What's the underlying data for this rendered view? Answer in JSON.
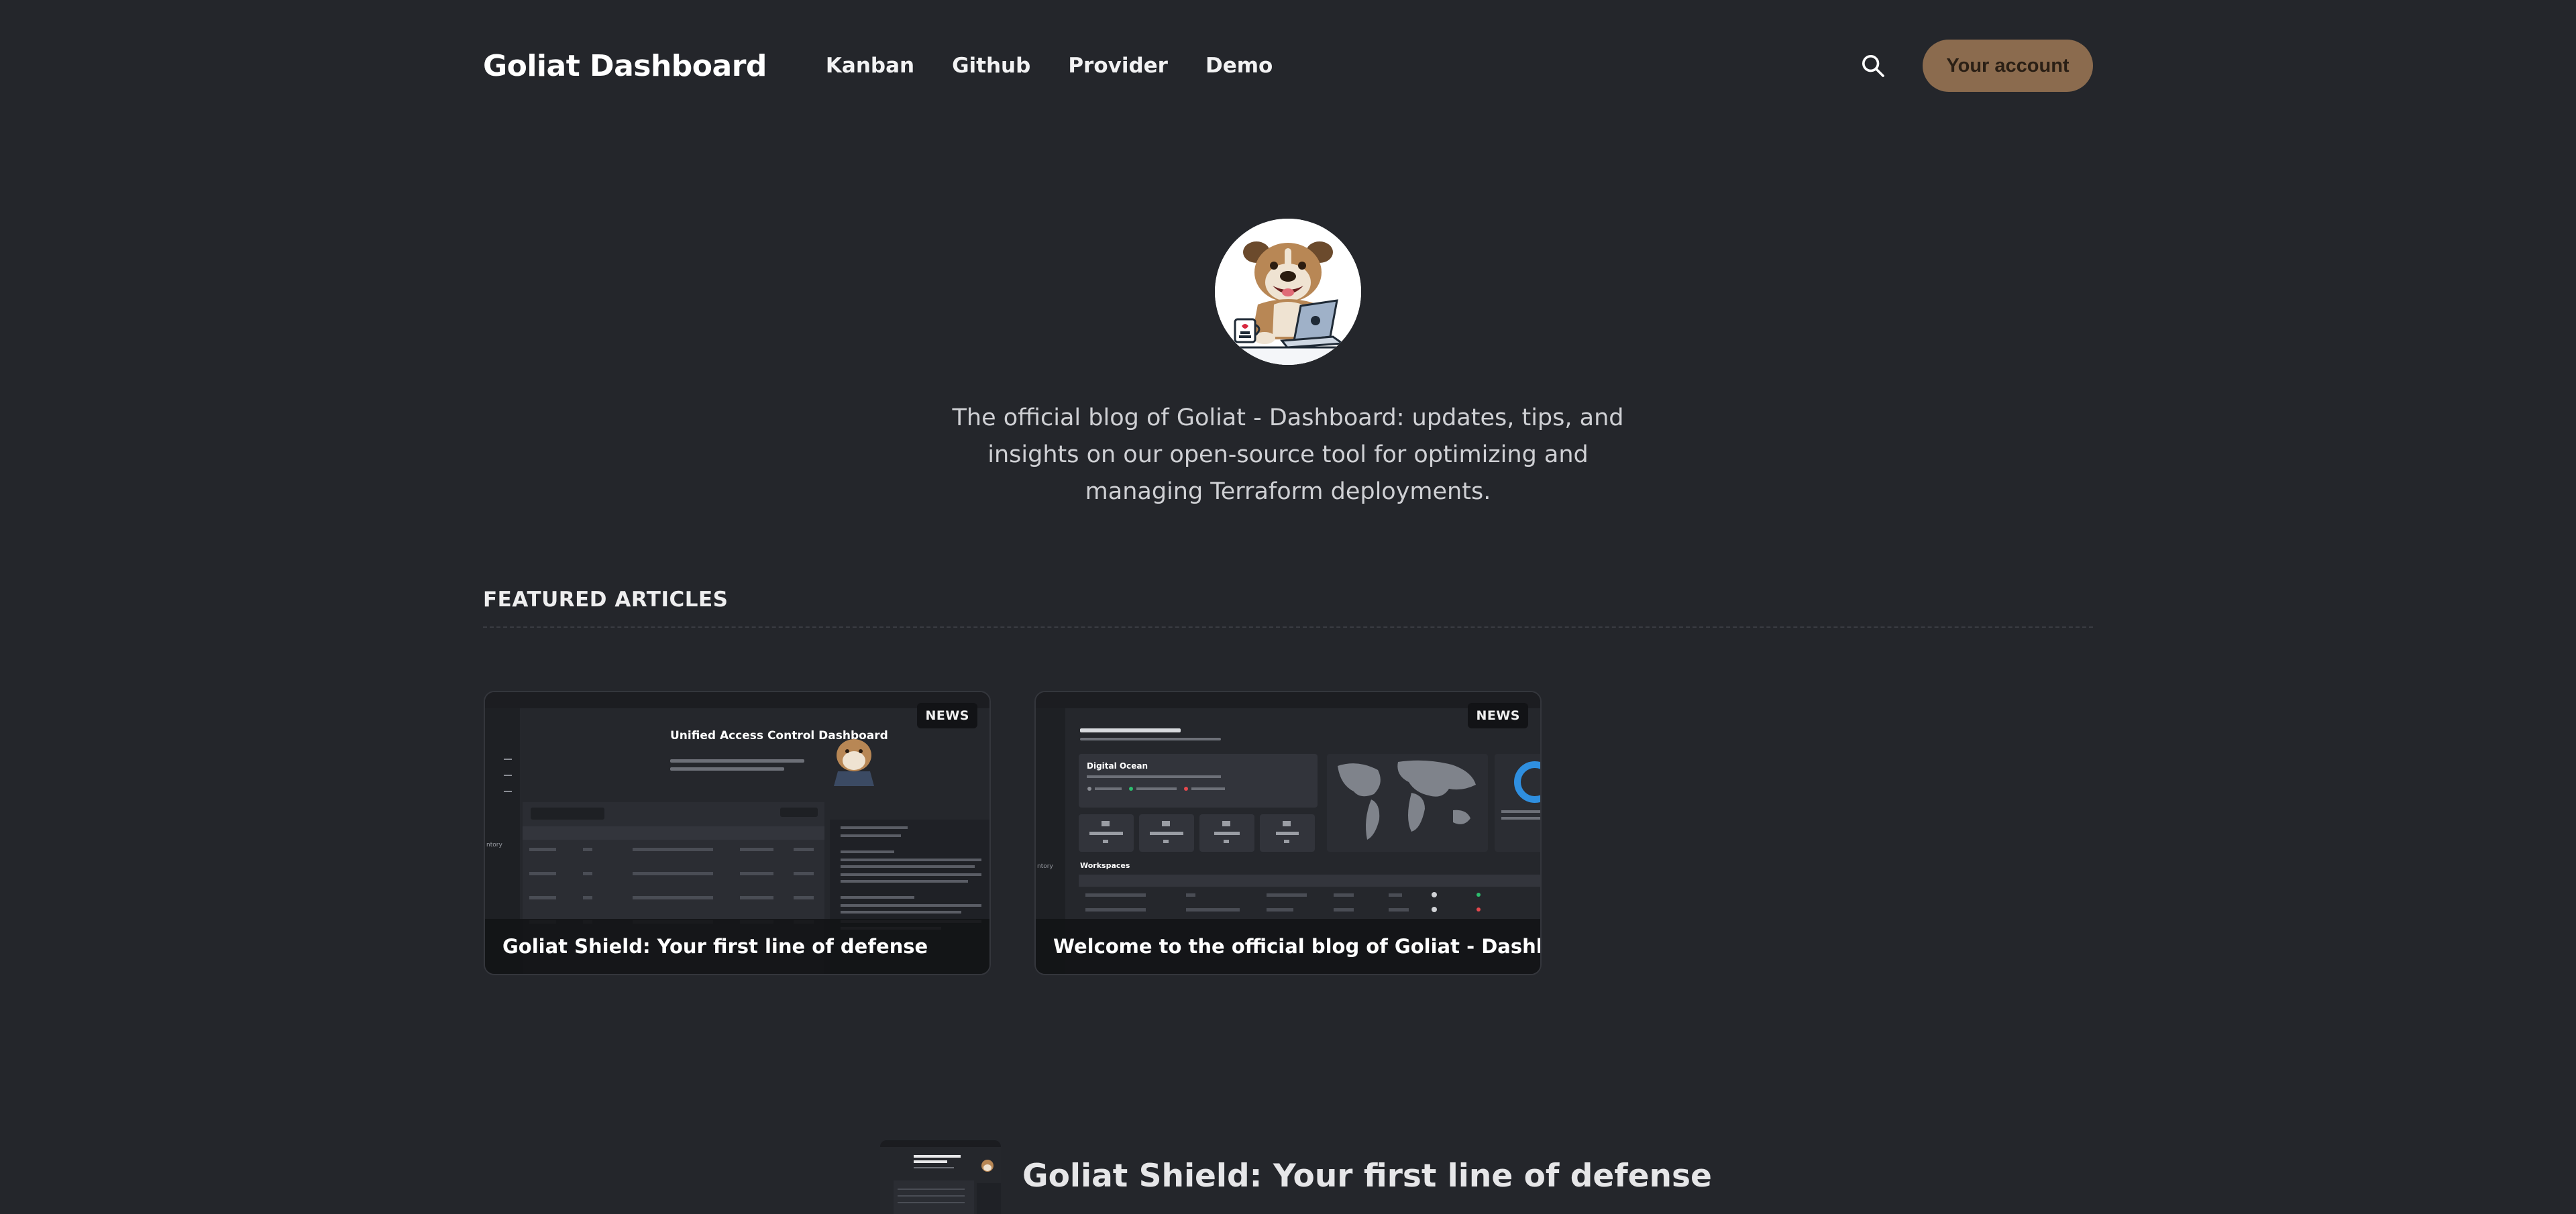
{
  "header": {
    "brand": "Goliat Dashboard",
    "nav": [
      "Kanban",
      "Github",
      "Provider",
      "Demo"
    ],
    "account_label": "Your account"
  },
  "hero": {
    "tagline": "The official blog of Goliat - Dashboard: updates, tips, and insights on our open-source tool for optimizing and managing Terraform deployments."
  },
  "featured": {
    "title": "FEATURED ARTICLES",
    "articles": [
      {
        "badge": "NEWS",
        "title": "Goliat Shield: Your first line of defense",
        "preview_heading": "Unified Access Control Dashboard"
      },
      {
        "badge": "NEWS",
        "title": "Welcome to the official blog of Goliat - Dashboard! 🚀",
        "preview_heading": "Digital Ocean",
        "preview_section": "Workspaces"
      }
    ]
  },
  "latest": {
    "title": "Goliat Shield: Your first line of defense"
  },
  "colors": {
    "background": "#24262b",
    "accent": "#8b6b4e"
  }
}
